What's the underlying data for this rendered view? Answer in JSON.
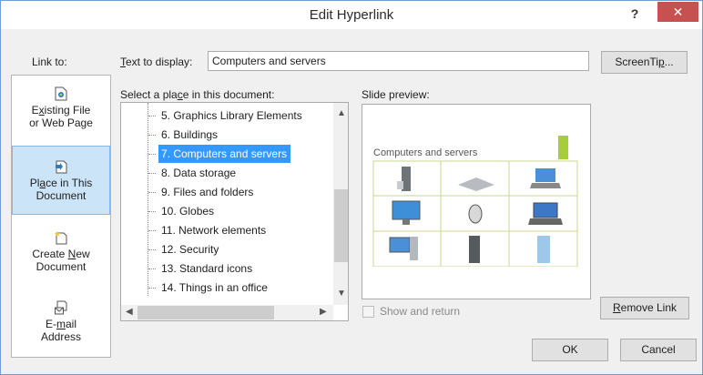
{
  "window": {
    "title": "Edit Hyperlink",
    "help": "?",
    "close": "✕"
  },
  "link_to": {
    "label": "Link to:",
    "items": [
      {
        "line1_pre": "E",
        "line1_key": "x",
        "line1_post": "isting File",
        "line2": "or Web Page",
        "icon": "existing-file-icon"
      },
      {
        "line1_pre": "Pl",
        "line1_key": "a",
        "line1_post": "ce in This",
        "line2": "Document",
        "icon": "place-in-document-icon",
        "selected": true
      },
      {
        "line1_pre": "Create ",
        "line1_key": "N",
        "line1_post": "ew",
        "line2": "Document",
        "icon": "create-new-document-icon"
      },
      {
        "line1_pre": "E-",
        "line1_key": "m",
        "line1_post": "ail",
        "line2": "Address",
        "icon": "email-address-icon"
      }
    ]
  },
  "text_to_display": {
    "label_key": "T",
    "label_rest": "ext to display:",
    "value": "Computers and servers"
  },
  "screentip": {
    "pre": "ScreenTi",
    "key": "p",
    "post": "..."
  },
  "place_list": {
    "label_pre": "Select a pla",
    "label_key": "c",
    "label_post": "e in this document:",
    "items": [
      {
        "text": "5. Graphics Library Elements"
      },
      {
        "text": "6. Buildings"
      },
      {
        "text": "7. Computers and servers",
        "selected": true
      },
      {
        "text": "8. Data storage"
      },
      {
        "text": "9. Files and folders"
      },
      {
        "text": "10. Globes"
      },
      {
        "text": "11. Network elements"
      },
      {
        "text": "12. Security"
      },
      {
        "text": "13. Standard icons"
      },
      {
        "text": "14. Things in an office"
      }
    ]
  },
  "slide_preview": {
    "label": "Slide preview:",
    "slide_title": "Computers and servers",
    "accent_color": "#a6ce39"
  },
  "show_and_return": {
    "label": "Show and return",
    "checked": false
  },
  "remove_link": {
    "key": "R",
    "rest": "emove Link"
  },
  "ok": "OK",
  "cancel": "Cancel",
  "colors": {
    "selection": "#3399ff",
    "link_selected": "#cce4f7",
    "close": "#c75050"
  }
}
